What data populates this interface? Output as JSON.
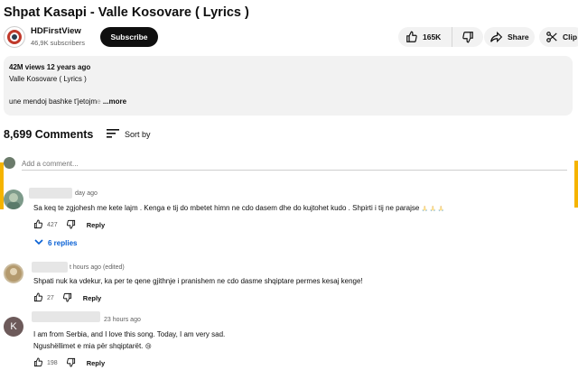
{
  "video": {
    "title": "Shpat Kasapi - Valle Kosovare ( Lyrics )"
  },
  "channel": {
    "name": "HDFirstView",
    "subscribers": "46,9K subscribers",
    "subscribe_label": "Subscribe"
  },
  "actions": {
    "likes": "165K",
    "share_label": "Share",
    "clip_label": "Clip"
  },
  "description": {
    "meta": "42M views  12 years ago",
    "line1": "Valle Kosovare ( Lyrics )",
    "text_visible": "une mendoj bashke t'jetojm",
    "text_faded": "e",
    "more_label": " ...more"
  },
  "comments_header": {
    "count": "8,699 Comments",
    "sort_label": "Sort by"
  },
  "add_comment": {
    "placeholder": "Add a comment..."
  },
  "comments": [
    {
      "time": "day ago",
      "text": "Sa keq te zgjohesh me kete lajm . Kenga e tij do mbetet himn ne cdo dasem dhe do kujtohet kudo . Shpirti i tij ne parajse",
      "emoji": "🙏 🙏 🙏",
      "likes": "427",
      "reply_label": "Reply",
      "replies_label": "6 replies"
    },
    {
      "time": "t hours ago (edited)",
      "text": "Shpati nuk ka vdekur, ka per te qene gjithnje i pranishem ne cdo dasme shqiptare permes kesaj kenge!",
      "likes": "27",
      "reply_label": "Reply"
    },
    {
      "time": "23 hours ago",
      "avatar_letter": "K",
      "text_line1": "I am from Serbia, and I love this song. Today, I am very sad.",
      "text_line2": "Ngushëllimet e mia për shqiptarët.",
      "emoji": "😢",
      "likes": "198",
      "reply_label": "Reply"
    }
  ],
  "colors": {
    "accent_link": "#065fd4",
    "scroll_marker": "#f5b400",
    "pill_bg": "#f2f2f2",
    "subscribe_bg": "#0f0f0f"
  }
}
